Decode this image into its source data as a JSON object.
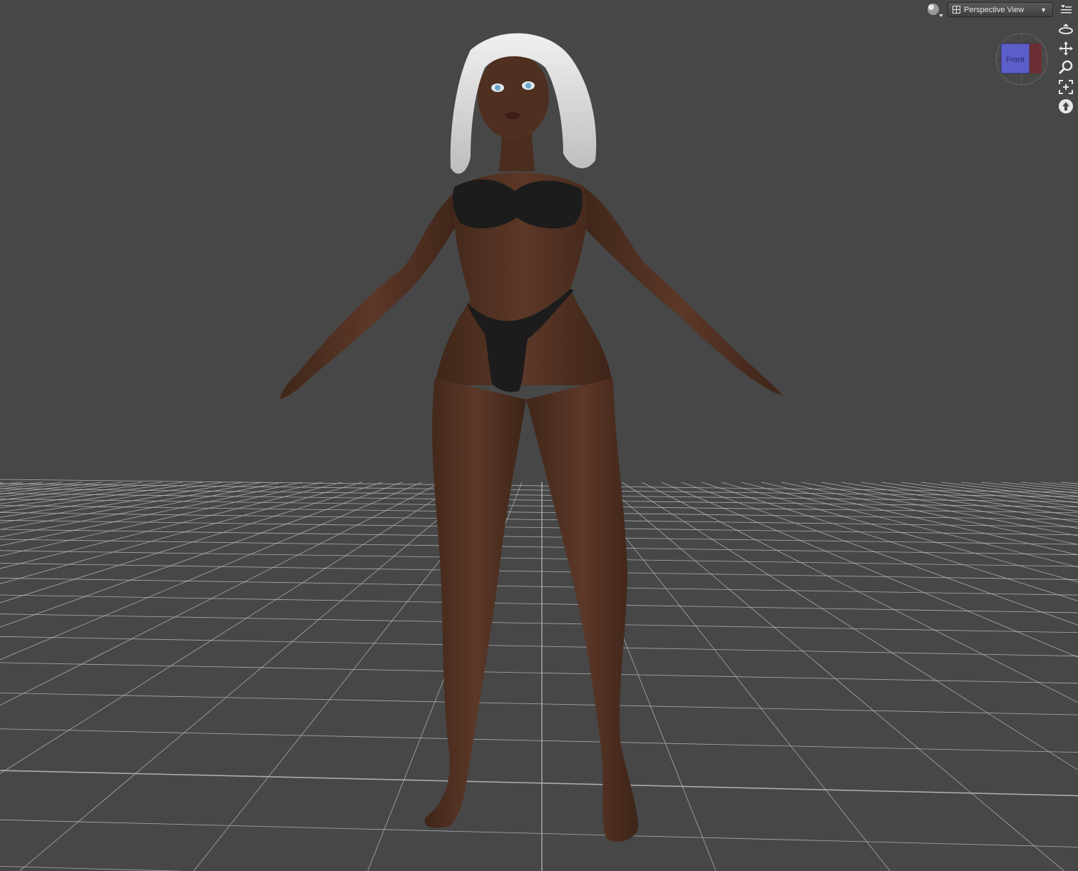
{
  "viewport": {
    "view_label": "Perspective View",
    "cube_label": "Front",
    "background_color": "#474747",
    "grid_color": "#bdbdbd"
  },
  "icons": {
    "shading": "shading-sphere-icon",
    "view_list": "view-list-icon",
    "dropdown": "chevron-down-icon",
    "menu": "viewport-menu-icon",
    "orbit": "orbit-icon",
    "pan": "pan-icon",
    "zoom": "zoom-icon",
    "frame": "frame-selection-icon",
    "reset": "reset-view-icon"
  }
}
